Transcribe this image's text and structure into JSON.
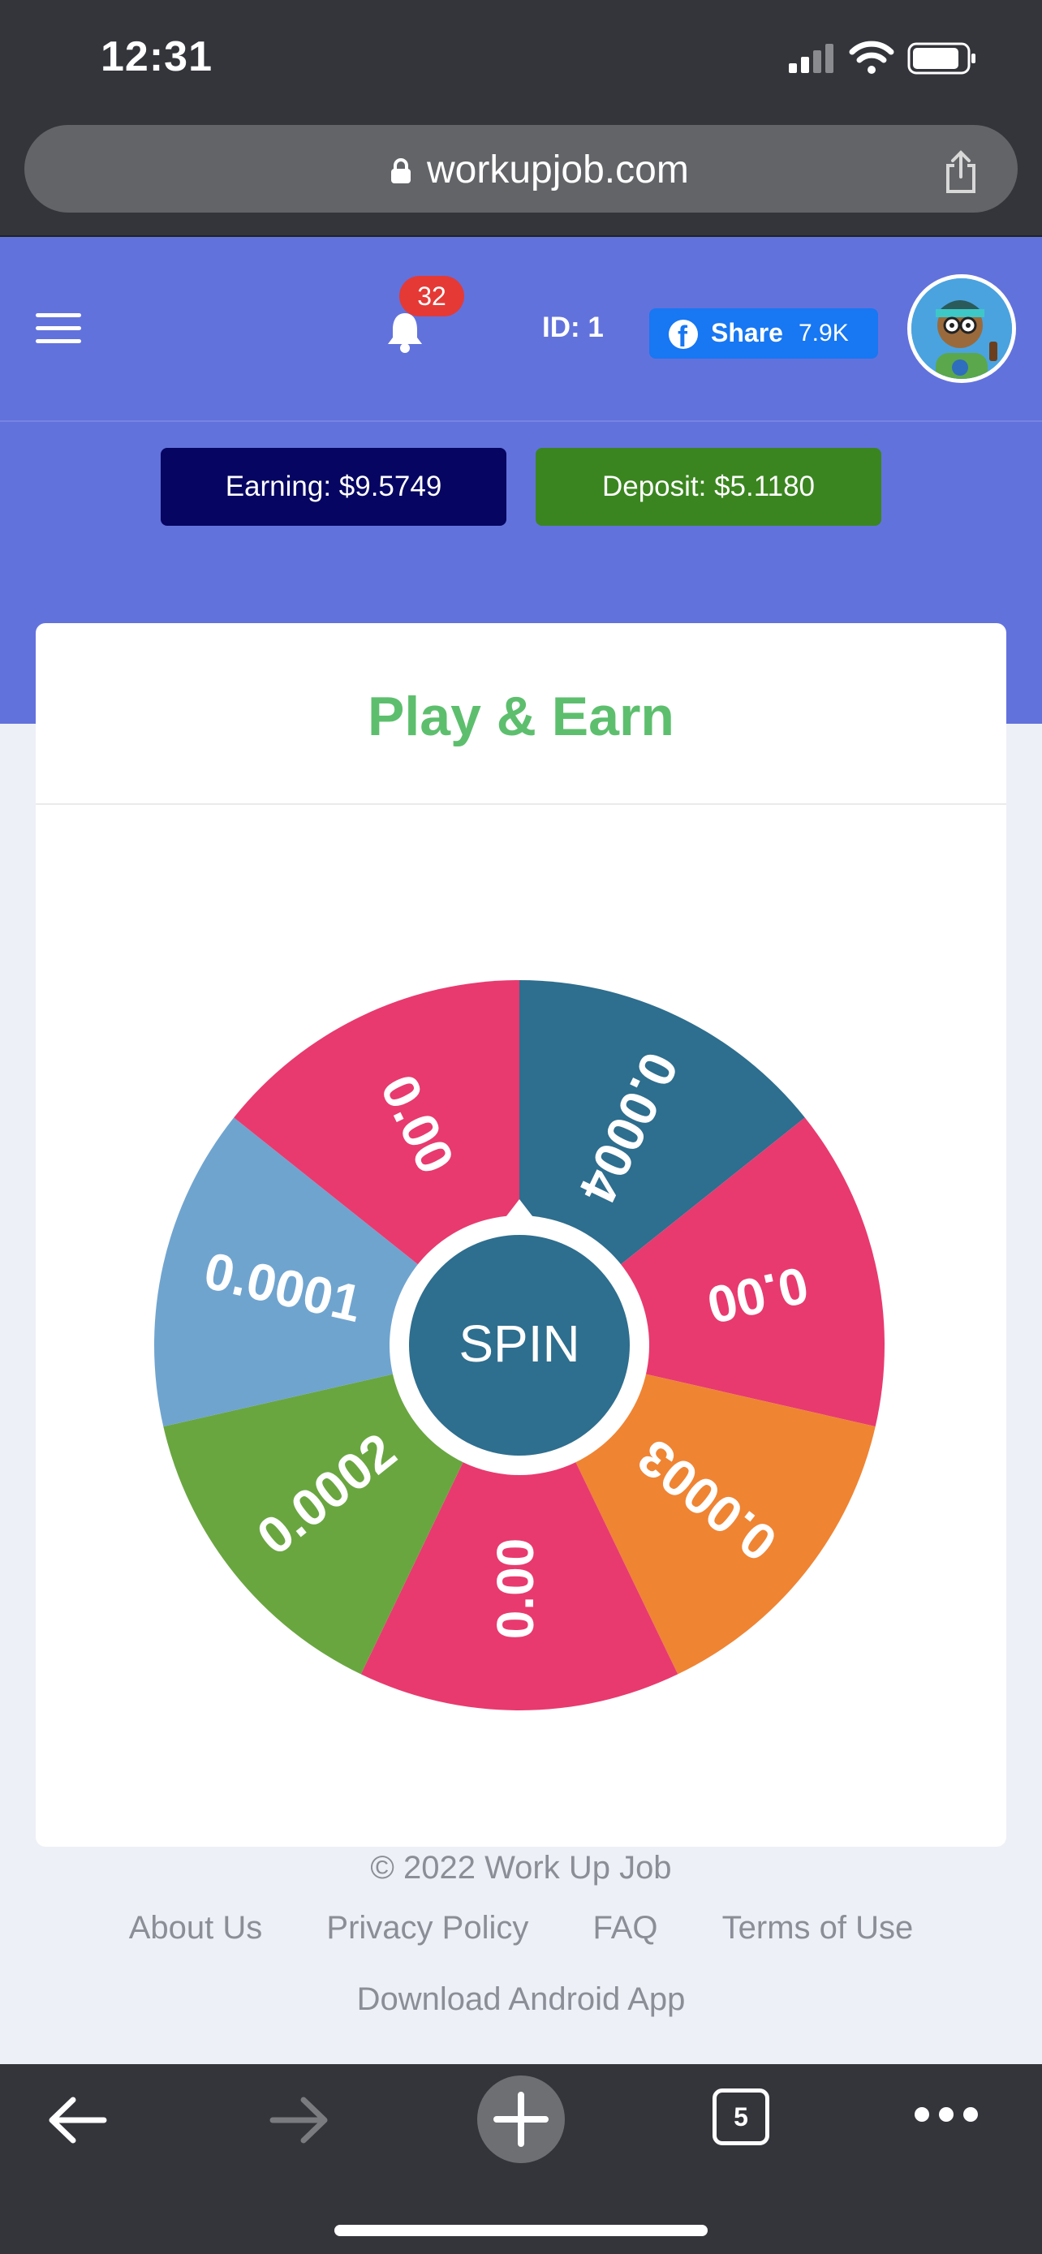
{
  "status_bar": {
    "time": "12:31"
  },
  "browser": {
    "url": "workupjob.com",
    "tab_count": "5"
  },
  "header": {
    "notification_count": "32",
    "user_id": "ID: 1",
    "share_label": "Share",
    "share_count": "7.9K",
    "earning": "Earning: $9.5749",
    "deposit": "Deposit: $5.1180"
  },
  "card": {
    "title": "Play & Earn",
    "spin_label": "SPIN"
  },
  "wheel": {
    "segments": [
      {
        "label": "0.0004",
        "color": "#2e6e8e"
      },
      {
        "label": "0.00",
        "color": "#e83a6f"
      },
      {
        "label": "0.0003",
        "color": "#ef8433"
      },
      {
        "label": "0.00",
        "color": "#e83a6f"
      },
      {
        "label": "0.0002",
        "color": "#69a640"
      },
      {
        "label": "0.0001",
        "color": "#6fa4cf"
      },
      {
        "label": "0.00",
        "color": "#e83a6f"
      }
    ]
  },
  "footer": {
    "copyright": "© 2022 Work Up Job",
    "links": [
      "About Us",
      "Privacy Policy",
      "FAQ",
      "Terms of Use"
    ],
    "android": "Download Android App"
  },
  "colors": {
    "header_bg": "#6272dc",
    "title_green": "#5dbf6e",
    "earning_bg": "#060561",
    "deposit_bg": "#3a851f"
  }
}
